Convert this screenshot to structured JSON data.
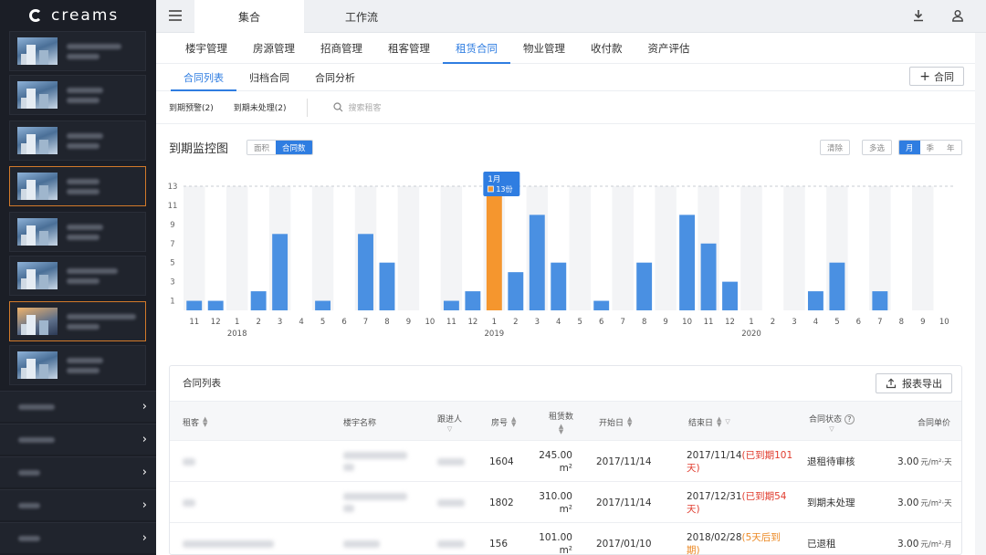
{
  "app": {
    "logo": "creams"
  },
  "sidebar": {
    "menu_chevron": "›"
  },
  "topbar": {
    "tabs": [
      "集合",
      "工作流"
    ],
    "download_icon": "download-icon",
    "user_icon": "user-icon"
  },
  "nav": {
    "primary": [
      "楼宇管理",
      "房源管理",
      "招商管理",
      "租客管理",
      "租赁合同",
      "物业管理",
      "收付款",
      "资产评估"
    ],
    "primary_active": "租赁合同",
    "secondary": [
      "合同列表",
      "归档合同",
      "合同分析"
    ],
    "secondary_active": "合同列表",
    "add_contract": "合同"
  },
  "filters": {
    "expiring": "到期预警(2)",
    "expired_unprocessed": "到期未处理(2)",
    "search_placeholder": "搜索租客"
  },
  "monitor": {
    "title": "到期监控图",
    "metric_toggle": [
      "面积",
      "合同数"
    ],
    "metric_active": "合同数",
    "clear": "清除",
    "multi_select": "多选",
    "period_toggle": [
      "月",
      "季",
      "年"
    ],
    "period_active": "月",
    "tooltip": {
      "title": "1月",
      "value": "13份"
    }
  },
  "chart_data": {
    "type": "bar",
    "title": "到期监控图",
    "yticks": [
      1,
      3,
      5,
      7,
      9,
      11,
      13
    ],
    "ylim": [
      0,
      13
    ],
    "categories": [
      "11",
      "12",
      "1",
      "2",
      "3",
      "4",
      "5",
      "6",
      "7",
      "8",
      "9",
      "10",
      "11",
      "12",
      "1",
      "2",
      "3",
      "4",
      "5",
      "6",
      "7",
      "8",
      "9",
      "10",
      "11",
      "12",
      "1",
      "2",
      "3",
      "4",
      "5",
      "6",
      "7",
      "8",
      "9",
      "10"
    ],
    "year_labels": [
      {
        "label": "2018",
        "index": 2
      },
      {
        "label": "2019",
        "index": 14
      },
      {
        "label": "2020",
        "index": 26
      }
    ],
    "values": [
      1,
      1,
      0,
      2,
      8,
      0,
      1,
      0,
      8,
      5,
      0,
      0,
      1,
      2,
      13,
      4,
      10,
      5,
      0,
      1,
      0,
      5,
      0,
      10,
      7,
      3,
      0,
      0,
      0,
      2,
      5,
      0,
      2,
      0,
      0,
      0
    ],
    "highlight_index": 14,
    "colors": {
      "bar": "#4a90e2",
      "highlight": "#f5962e",
      "band": "#f3f4f6"
    }
  },
  "table": {
    "title": "合同列表",
    "export": "报表导出",
    "headers": [
      "租客",
      "楼宇名称",
      "跟进人",
      "房号",
      "租赁数",
      "开始日",
      "结束日",
      "合同状态",
      "合同单价"
    ],
    "rows": [
      {
        "room": "1604",
        "area": "245.00",
        "area_unit": "m²",
        "start": "2017/11/14",
        "end": "2017/11/14",
        "end_note": "(已到期101天)",
        "end_note_a": "(已到期101",
        "end_note_b": "天)",
        "note_color": "red",
        "status": "退租待审核",
        "price": "3.00",
        "price_unit": "元/m²·天"
      },
      {
        "room": "1802",
        "area": "310.00",
        "area_unit": "m²",
        "start": "2017/11/14",
        "end": "2017/12/31",
        "end_note_a": "(已到期54",
        "end_note_b": "天)",
        "note_color": "red",
        "status": "到期未处理",
        "price": "3.00",
        "price_unit": "元/m²·天"
      },
      {
        "room": "156",
        "area": "101.00",
        "area_unit": "m²",
        "start": "2017/01/10",
        "end": "2018/02/28",
        "end_note_a": "(5天后到",
        "end_note_b": "期)",
        "note_color": "orange",
        "status": "已退租",
        "price": "3.00",
        "price_unit": "元/m²·月"
      }
    ]
  }
}
